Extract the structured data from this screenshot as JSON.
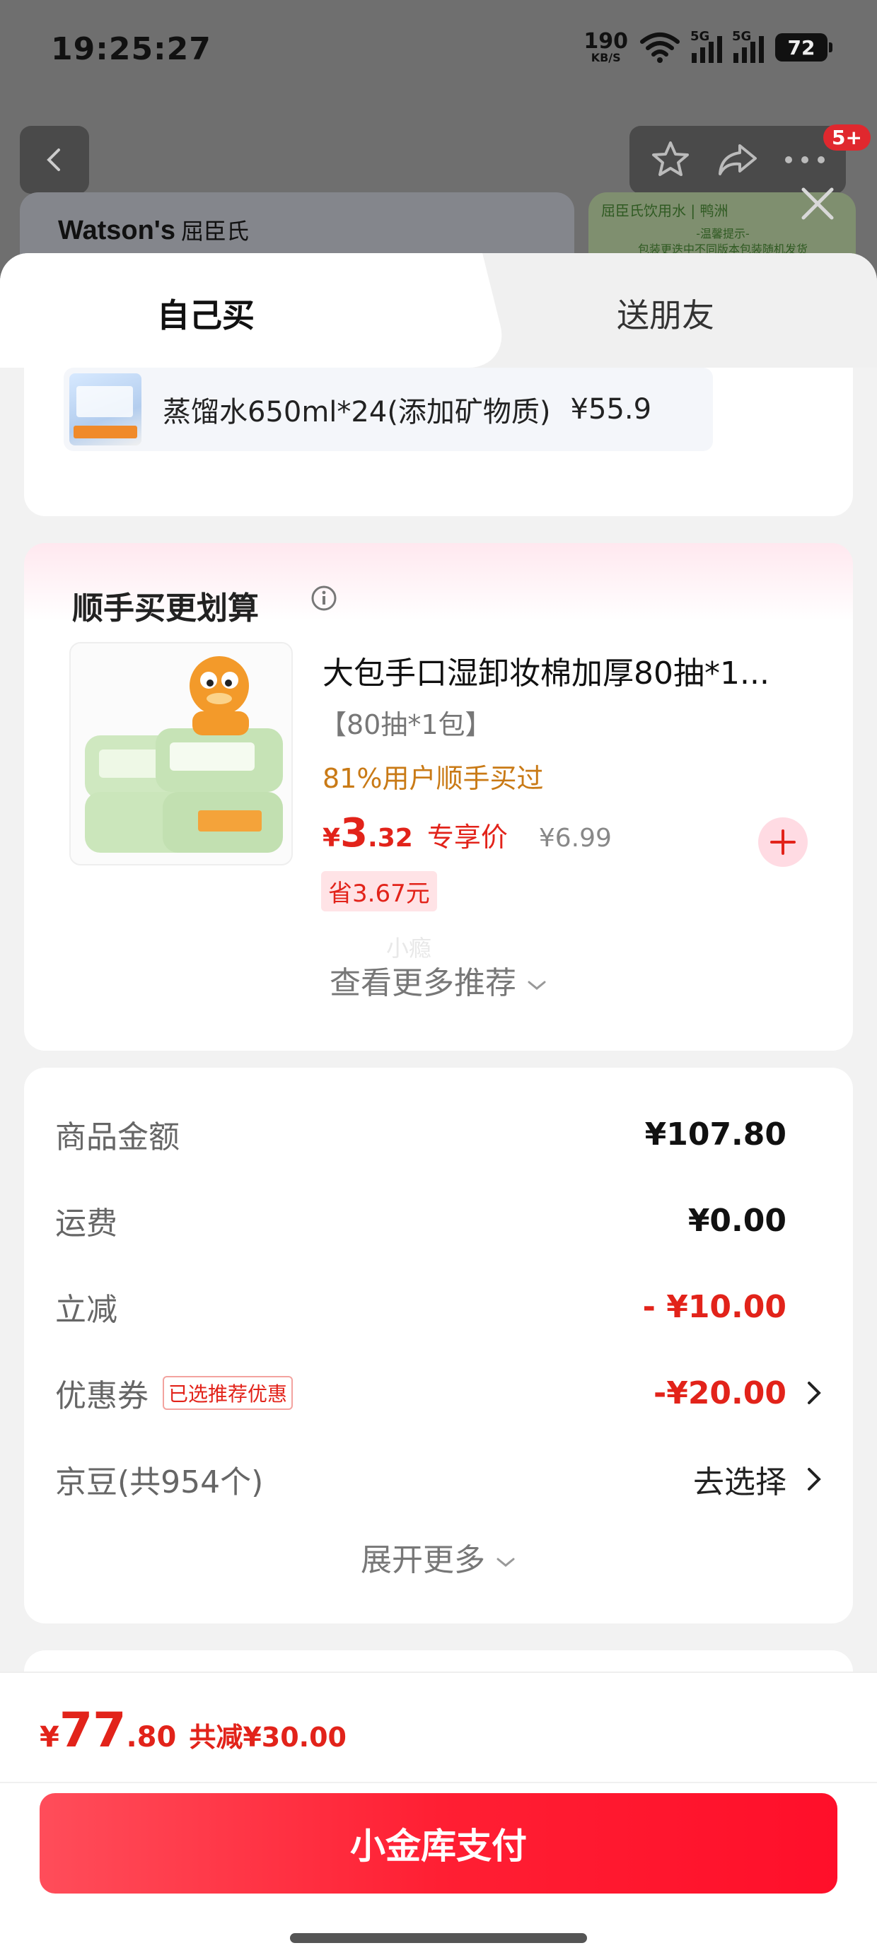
{
  "status_bar": {
    "time": "19:25:27",
    "net_speed": "190",
    "net_unit": "KB/S",
    "sim1": "5G",
    "sim2": "5G",
    "battery": "72"
  },
  "background_page": {
    "store_brand": "Watson's",
    "store_cn": "屈臣氏",
    "promo_title": "屈臣氏饮用水 | 鸭洲",
    "promo_sub": "-温馨提示-\n包装更迭中不同版本包装随机发货",
    "badge": "5+"
  },
  "tabs": [
    {
      "label": "自己买",
      "active": true
    },
    {
      "label": "送朋友",
      "active": false
    }
  ],
  "selected_item": {
    "name": "蒸馏水650ml*24(添加矿物质)",
    "price": "¥55.9"
  },
  "addon": {
    "title": "顺手买更划算",
    "product_name": "大包手口湿卸妆棉加厚80抽*1...",
    "spec": "【80抽*1包】",
    "social_proof": "81%用户顺手买过",
    "price_yen": "¥",
    "price_int": "3",
    "price_dec": ".32",
    "price_tag": "专享价",
    "original_price": "¥6.99",
    "save": "省3.67元",
    "watermark": "小瘾",
    "more_link": "查看更多推荐"
  },
  "summary": {
    "rows": [
      {
        "label": "商品金额",
        "value": "¥107.80"
      },
      {
        "label": "运费",
        "value": "¥0.00"
      },
      {
        "label": "立减",
        "value": "- ¥10.00"
      },
      {
        "label": "优惠券",
        "tag": "已选推荐优惠",
        "value": "-¥20.00"
      },
      {
        "label": "京豆(共954个)",
        "value": "去选择"
      }
    ],
    "expand": "展开更多"
  },
  "footer": {
    "total_yen": "¥",
    "total_int": "77",
    "total_dec": ".80",
    "reduce_text": "共减¥30.00",
    "pay_button": "小金库支付"
  },
  "colors": {
    "accent_red": "#e2231a",
    "social_orange": "#c97a16",
    "pay_gradient_start": "#ff4d5a",
    "pay_gradient_end": "#ff0f2a"
  }
}
